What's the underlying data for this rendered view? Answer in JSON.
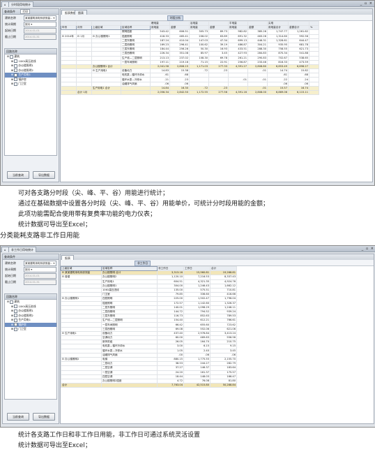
{
  "screen1": {
    "window_tab": "分时段用电统计",
    "window_controls": "_ ▫ ×",
    "filter_header": "查询条件",
    "report_button": "打印",
    "fields": [
      {
        "label": "建筑名称",
        "value": "某某建筑用电系统测量..."
      },
      {
        "label": "统计周期",
        "value": "按月"
      },
      {
        "label": "起始日期",
        "value": "2014-01-01"
      },
      {
        "label": "截止日期",
        "value": "2014-01-31"
      }
    ],
    "tree_header": "回路名称",
    "tree_items": [
      {
        "label": "建筑",
        "level": 0,
        "selected": false
      },
      {
        "label": "10KV高压进线",
        "level": 1,
        "selected": false
      },
      {
        "label": "办公楼照明1",
        "level": 1,
        "selected": false
      },
      {
        "label": "办公楼照明2",
        "level": 1,
        "selected": false
      },
      {
        "label": "生产用电1",
        "level": 1,
        "selected": true
      },
      {
        "label": "锅炉房",
        "level": 1,
        "selected": false
      },
      {
        "label": "门卫室",
        "level": 1,
        "selected": false
      }
    ],
    "btn_query": "当前查询",
    "btn_export": "导出数据",
    "tabs": [
      "报表数据",
      "图表"
    ],
    "grid_tab": "时段分析",
    "col_headers_top": [
      "",
      "",
      "",
      "",
      "峰电量",
      "",
      "谷电量",
      "",
      "平电量",
      "",
      "尖电",
      "",
      ""
    ],
    "col_headers_sub": [
      "年份",
      "月份",
      "上级区域",
      "区域名称",
      "用电量",
      "金额",
      "用电量",
      "金额",
      "用电量",
      "金额",
      "用电量合计",
      "金额合计",
      "%"
    ],
    "rows": [
      {
        "c": [
          "",
          "",
          "",
          " 照明插座",
          "543.42",
          "606.51",
          "305.73",
          "89.73",
          "982.82",
          "385.26",
          "1,747.77",
          "1,261.62",
          ""
        ],
        "t": ""
      },
      {
        "c": [
          "⊟ 2014年",
          "⊟ 1月",
          "⊟ 办公楼照明1",
          " 插座照明",
          "418.33",
          "465.41",
          "206.02",
          "63.89",
          "691.32",
          "463.26",
          "1,314.60",
          "992.56",
          ""
        ],
        "t": ""
      },
      {
        "c": [
          "",
          "",
          "",
          " 二层东照明",
          "187.24",
          "410.04",
          "147.03",
          "47.34",
          "699.13",
          "446.31",
          "1,328.61",
          "644.47",
          ""
        ],
        "t": ""
      },
      {
        "c": [
          "",
          "",
          "",
          " 二层西照明",
          "169.23",
          "296.41",
          "100.62",
          "39.19",
          "486.87",
          "304.21",
          "935.95",
          "681.78",
          ""
        ],
        "t": ""
      },
      {
        "c": [
          "",
          "",
          "",
          " 三层东照明",
          "184.44",
          "256.26",
          "50.30",
          "16.93",
          "433.51",
          "288.30",
          "758.55",
          "621.73",
          ""
        ],
        "t": ""
      },
      {
        "c": [
          "",
          "",
          "",
          " 三层西照明",
          "226.34",
          "351.08",
          "85.97",
          "3.45",
          "427.93",
          "284.83",
          "870.34",
          "541.88",
          ""
        ],
        "t": ""
      },
      {
        "c": [
          "",
          "",
          "",
          " 生产线—二层照明",
          "213.13",
          "237.02",
          "108.30",
          "69.78",
          "261.21",
          "290.83",
          "702.67",
          "538.65",
          ""
        ],
        "t": ""
      },
      {
        "c": [
          "",
          "",
          "",
          " 一层车间照明",
          "197.11",
          "219.16",
          "71.15",
          "22.91",
          "256.87",
          "233.46",
          "816.33",
          "473.59",
          ""
        ],
        "t": ""
      },
      {
        "c": [
          "",
          "",
          "办公楼照明1 合计",
          "",
          "2,041.58",
          "2,806.15",
          "1,171.03",
          "277.33",
          "4,391.27",
          "2,808.80",
          "6,853.49",
          "6,898.27",
          ""
        ],
        "t": "tot"
      },
      {
        "c": [
          "",
          "",
          "⊟ 生产用电1",
          " 设备动力",
          "14.83",
          "15.38",
          ".72",
          ".23",
          "",
          ".01",
          "14.74",
          "15.82",
          ""
        ],
        "t": ""
      },
      {
        "c": [
          "",
          "",
          "",
          " 电机泵—循环冷却水",
          ".61",
          ".68",
          "",
          "",
          "",
          "",
          ".61",
          ".68",
          ""
        ],
        "t": ""
      },
      {
        "c": [
          "",
          "",
          "",
          " 循环水泵—冷却水",
          ".21",
          ".23",
          "",
          "",
          ".01",
          ".01",
          ".22",
          ".24",
          ""
        ],
        "t": ""
      },
      {
        "c": [
          "",
          "",
          "",
          " 油烟排气风扇",
          ".06",
          ".06",
          "",
          "",
          "",
          "",
          ".06",
          ".06",
          ""
        ],
        "t": ""
      },
      {
        "c": [
          "",
          "",
          "生产用电1 合计",
          "",
          "14.84",
          "16.30",
          ".72",
          ".23",
          "",
          ".01",
          "15.57",
          "16.74",
          ""
        ],
        "t": "tot"
      },
      {
        "c": [
          "",
          "合计 1月",
          "",
          "",
          "2,056.34",
          "2,842.50",
          "1,172.55",
          "277.56",
          "4,391.16",
          "2,808.00",
          "6,869.06",
          "6,115.11",
          ""
        ],
        "t": "tot"
      }
    ]
  },
  "caption1": [
    "可对各支路分时段（尖、峰、平、谷）用能进行统计；",
    "通过在基础数据中设置各分时段（尖、峰、平、谷）用能单价，可统计分时段用能的金额；",
    "此项功能需配合使用带有复费率功能的电力仪表；",
    "统计数据可导出至Excel；"
  ],
  "section_title": "分类能耗支路非工作日用能",
  "screen2": {
    "window_tab": "非工作日用电统计",
    "window_controls": "_ ▫ ×",
    "filter_header": "查询条件",
    "fields": [
      {
        "label": "建筑名称",
        "value": "某某建筑用电系统测量..."
      },
      {
        "label": "统计周期",
        "value": "按月"
      },
      {
        "label": "起始日期",
        "value": "2014-01-01"
      },
      {
        "label": "截止日期",
        "value": "2014-01-31"
      }
    ],
    "tree_header": "回路名称",
    "tree_items": [
      {
        "label": "建筑",
        "level": 0,
        "selected": false
      },
      {
        "label": "10KV高压进线",
        "level": 1,
        "selected": false
      },
      {
        "label": "办公楼照明1",
        "level": 1,
        "selected": false
      },
      {
        "label": "办公楼照明2",
        "level": 1,
        "selected": false
      },
      {
        "label": "生产用电1",
        "level": 1,
        "selected": false
      },
      {
        "label": "锅炉房",
        "level": 1,
        "selected": true
      },
      {
        "label": "门卫室",
        "level": 1,
        "selected": false
      }
    ],
    "btn_query": "当前查询",
    "btn_export": "导出数据",
    "tabs": [
      "报表"
    ],
    "grid_tab": "非工作日",
    "col_headers": [
      "上级区域",
      "区域名称",
      "非工作日",
      "工作日",
      "合计"
    ],
    "rows": [
      {
        "c": [
          "⊟ 某某建筑用电系统测量",
          "办公楼照明 合计",
          "3,313.16",
          "15,960.81",
          "19,268.81"
        ],
        "t": "tot2"
      },
      {
        "c": [
          "⊟ 各楼",
          "办公楼照明2",
          "1,120.10",
          "7,216.53",
          "8,337.43"
        ],
        "t": ""
      },
      {
        "c": [
          "",
          "生产用电1",
          "604.51",
          "4,321.35",
          "4,924.76"
        ],
        "t": ""
      },
      {
        "c": [
          "",
          "办公楼照明1",
          "304.00",
          "1,246.43",
          "1,662.12"
        ],
        "t": ""
      },
      {
        "c": [
          "",
          "10KV高压进线",
          "135.00",
          "575.51",
          "710.81"
        ],
        "t": ""
      },
      {
        "c": [
          "",
          "门卫室",
          "79.85",
          "336.60",
          "416.66"
        ],
        "t": ""
      },
      {
        "c": [
          "⊟ 办公楼照明1",
          "四层照明",
          "225.00",
          "1,502.47",
          "1,796.04"
        ],
        "t": ""
      },
      {
        "c": [
          "",
          "插座照明",
          "172.57",
          "1,142.60",
          "1,326.37"
        ],
        "t": ""
      },
      {
        "c": [
          "",
          "二层东照明",
          "140.01",
          "1,098.29",
          "1,246.11"
        ],
        "t": ""
      },
      {
        "c": [
          "",
          "二层西照明",
          "144.72",
          "794.52",
          "939.24"
        ],
        "t": ""
      },
      {
        "c": [
          "",
          "三层东照明",
          "116.73",
          "852.63",
          "789.53"
        ],
        "t": ""
      },
      {
        "c": [
          "",
          "生产线—二层照明",
          "154.40",
          "612.21",
          "766.61"
        ],
        "t": ""
      },
      {
        "c": [
          "",
          "一层车间照明",
          "66.42",
          "655.60",
          "723.62"
        ],
        "t": ""
      },
      {
        "c": [
          "",
          "三层西照明",
          "69.08",
          "552.06",
          "621.06"
        ],
        "t": ""
      },
      {
        "c": [
          "⊟ 生产用电1",
          "设备动力",
          "437.40",
          "2,976.84",
          "3,413.24"
        ],
        "t": ""
      },
      {
        "c": [
          "",
          "空调动力",
          "60.00",
          "469.63",
          "556.56"
        ],
        "t": ""
      },
      {
        "c": [
          "",
          "新风机组",
          "26.05",
          "164.70",
          "210.75"
        ],
        "t": ""
      },
      {
        "c": [
          "",
          "电机泵—循环冷却水",
          "3.00",
          "6.15",
          "9.15"
        ],
        "t": ""
      },
      {
        "c": [
          "",
          "循环水泵—冷却水",
          "1.05",
          "2.40",
          "3.45"
        ],
        "t": ""
      },
      {
        "c": [
          "",
          "油烟排气风扇",
          ".00",
          ".06",
          ".06"
        ],
        "t": ""
      },
      {
        "c": [
          "⊟ 办公楼照明2",
          "电梯",
          "880.15",
          "1,775.55",
          "2,155.70"
        ],
        "t": ""
      },
      {
        "c": [
          "",
          "二层动力",
          "38.53",
          "244.27",
          "282.79"
        ],
        "t": ""
      },
      {
        "c": [
          "",
          "二层空调",
          "37.27",
          "146.37",
          "183.64"
        ],
        "t": ""
      },
      {
        "c": [
          "",
          "一层空调",
          "24.20",
          "161.37",
          "175.57"
        ],
        "t": ""
      },
      {
        "c": [
          "",
          "四层空调",
          "18.44",
          "148.03",
          "166.47"
        ],
        "t": ""
      },
      {
        "c": [
          "",
          "办公楼照明2插座",
          "4.72",
          "76.08",
          "81.80"
        ],
        "t": ""
      },
      {
        "c": [
          "合计",
          "",
          "7,763.04",
          "42,515.80",
          "50,288.84"
        ],
        "t": "tot2"
      }
    ]
  },
  "caption2": [
    "统计各支路工作日和非工作日用能，非工作日可通过系统灵活设置",
    "统计数据可导出至Excel；"
  ]
}
